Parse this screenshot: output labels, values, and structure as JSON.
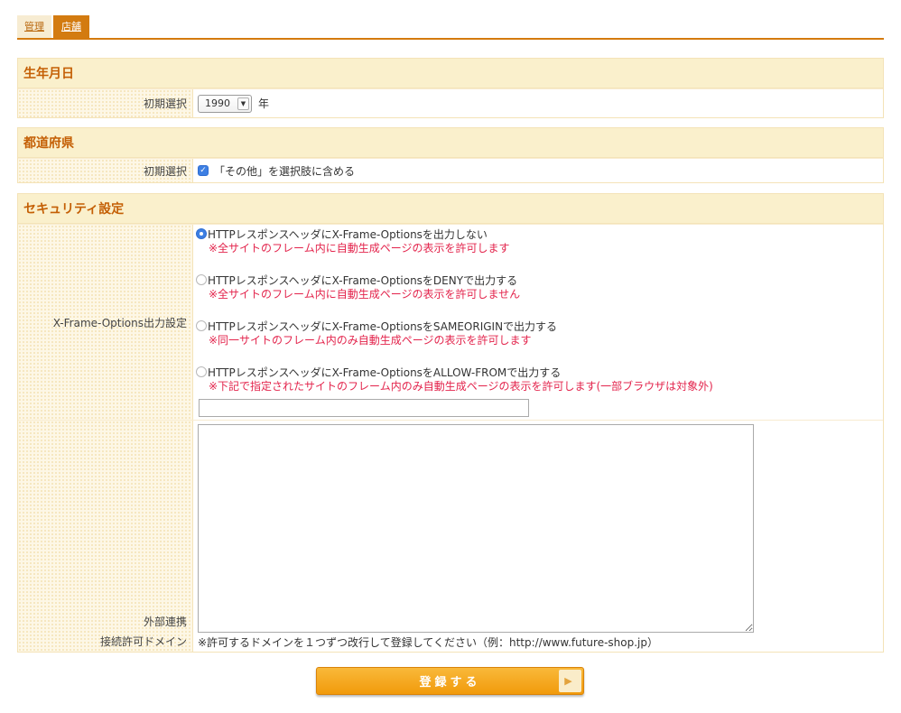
{
  "tabs": [
    {
      "label": "管理"
    },
    {
      "label": "店舗"
    }
  ],
  "birthdate": {
    "title": "生年月日",
    "label": "初期選択",
    "year_value": "1990",
    "suffix": "年"
  },
  "prefecture": {
    "title": "都道府県",
    "label": "初期選択",
    "checkbox_label": "「その他」を選択肢に含める",
    "checked": true
  },
  "security": {
    "title": "セキュリティ設定",
    "xfo_label": "X-Frame-Options出力設定",
    "options": [
      {
        "label": "HTTPレスポンスヘッダにX-Frame-Optionsを出力しない",
        "note": "※全サイトのフレーム内に自動生成ページの表示を許可します",
        "selected": true
      },
      {
        "label": "HTTPレスポンスヘッダにX-Frame-OptionsをDENYで出力する",
        "note": "※全サイトのフレーム内に自動生成ページの表示を許可しません",
        "selected": false
      },
      {
        "label": "HTTPレスポンスヘッダにX-Frame-OptionsをSAMEORIGINで出力する",
        "note": "※同一サイトのフレーム内のみ自動生成ページの表示を許可します",
        "selected": false
      },
      {
        "label": "HTTPレスポンスヘッダにX-Frame-OptionsをALLOW-FROMで出力する",
        "note": "※下記で指定されたサイトのフレーム内のみ自動生成ページの表示を許可します(一部ブラウザは対象外)",
        "selected": false
      }
    ],
    "allow_from_value": "",
    "external_label_line1": "外部連携",
    "external_label_line2": "接続許可ドメイン",
    "domains_value": "",
    "domains_hint": "※許可するドメインを１つずつ改行して登録してください（例：http://www.future-shop.jp）"
  },
  "submit": {
    "label": "登録する"
  },
  "colors": {
    "accent": "#d37b10",
    "header_bg": "#faf0cc",
    "note_red": "#e3244c",
    "radio_blue": "#3d7fe3"
  }
}
